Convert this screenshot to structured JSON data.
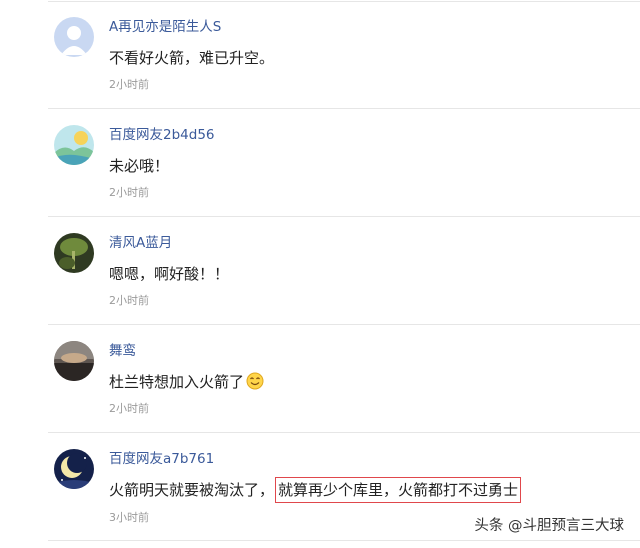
{
  "comments": [
    {
      "user": "A再见亦是陌生人S",
      "text": "不看好火箭，难已升空。",
      "time": "2小时前",
      "avatar": "default-avatar"
    },
    {
      "user": "百度网友2b4d56",
      "text": "未必哦！",
      "time": "2小时前",
      "avatar": "landscape-avatar"
    },
    {
      "user": "清风A蓝月",
      "text": "嗯嗯，啊好酸！！",
      "time": "2小时前",
      "avatar": "plant-avatar"
    },
    {
      "user": "舞鸾",
      "text": "杜兰特想加入火箭了",
      "time": "2小时前",
      "avatar": "sunset-avatar",
      "emoji": "smiley-emoji"
    },
    {
      "user": "百度网友a7b761",
      "text_before": "火箭明天就要被淘汰了，",
      "text_highlight": "就算再少个库里，火箭都打不过勇士",
      "time": "3小时前",
      "avatar": "moon-avatar"
    }
  ],
  "watermark": "头条 @斗胆预言三大球",
  "colors": {
    "username": "#3b5a9a",
    "highlight_border": "#e0474c"
  }
}
